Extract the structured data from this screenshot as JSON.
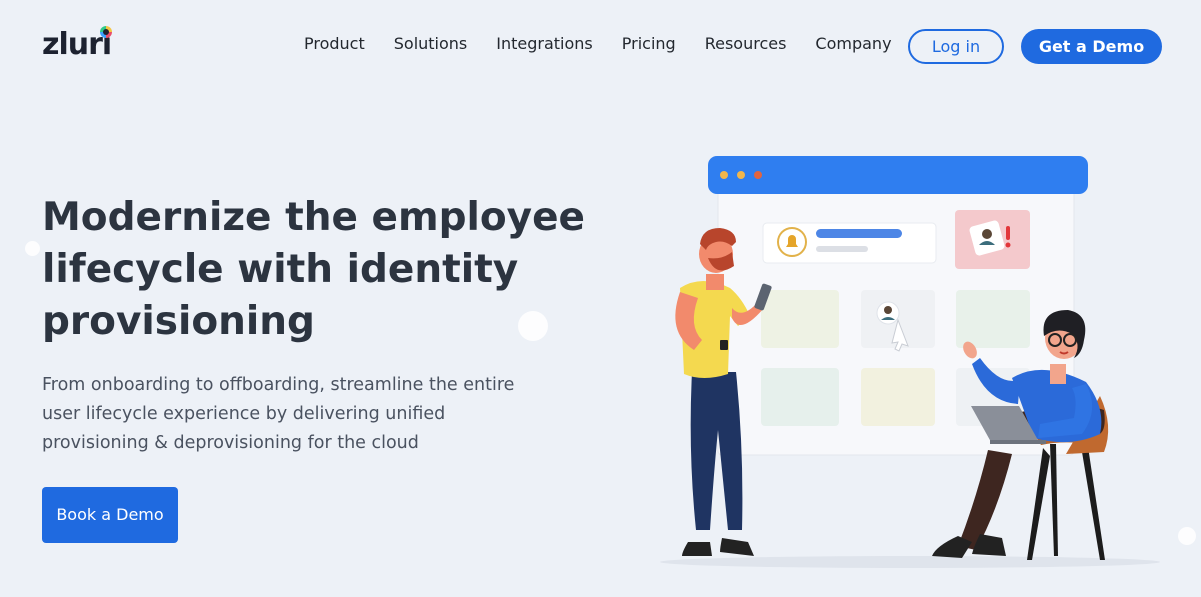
{
  "brand": {
    "logo_text": "zluri"
  },
  "nav": {
    "items": [
      "Product",
      "Solutions",
      "Integrations",
      "Pricing",
      "Resources",
      "Company"
    ],
    "login_label": "Log in",
    "demo_label": "Get a Demo"
  },
  "hero": {
    "title": "Modernize the employee lifecycle with identity provisioning",
    "subtitle": "From onboarding to offboarding, streamline the entire user lifecycle experience by delivering unified provisioning & deprovisioning for the cloud",
    "cta_label": "Book a Demo"
  },
  "colors": {
    "accent": "#1f6ae0",
    "background": "#edf1f7",
    "heading": "#2c3440"
  },
  "illustration": {
    "name": "people-with-dashboard-illustration",
    "icons": [
      "bell-icon",
      "user-alert-icon",
      "cursor-hand-icon"
    ]
  }
}
